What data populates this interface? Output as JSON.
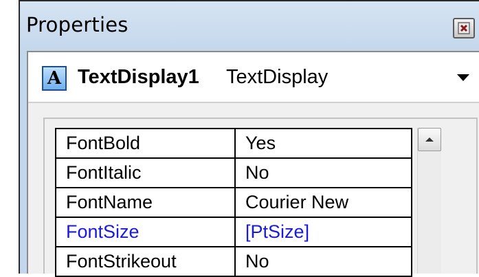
{
  "window": {
    "title": "Properties"
  },
  "selector": {
    "icon_letter": "A",
    "object_name": "TextDisplay1",
    "object_type": "TextDisplay"
  },
  "properties": [
    {
      "name": "FontBold",
      "value": "Yes",
      "is_link": false
    },
    {
      "name": "FontItalic",
      "value": "No",
      "is_link": false
    },
    {
      "name": "FontName",
      "value": "Courier New",
      "is_link": false
    },
    {
      "name": "FontSize",
      "value": "[PtSize]",
      "is_link": true
    },
    {
      "name": "FontStrikeout",
      "value": "No",
      "is_link": false
    }
  ],
  "colors": {
    "link_text": "#1a1adc",
    "titlebar": "#c3d7ec",
    "icon_fill": "#6fb0f0"
  },
  "icons": {
    "close": "close-icon",
    "object": "text-display-icon",
    "dropdown": "chevron-down-icon",
    "scroll_up": "scroll-up-arrow-icon"
  }
}
